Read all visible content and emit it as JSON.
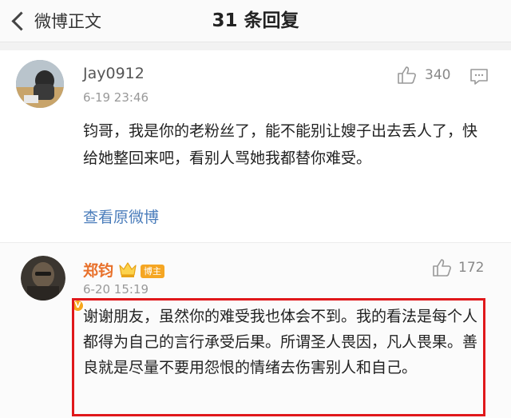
{
  "nav": {
    "back_label": "微博正文",
    "title": "31 条回复"
  },
  "comments": [
    {
      "username": "Jay0912",
      "time": "6-19 23:46",
      "likes": "340",
      "text": "钧哥，我是你的老粉丝了，能不能别让嫂子出去丢人了，快给她整回来吧，看别人骂她我都替你难受。",
      "link_label": "查看原微博"
    },
    {
      "username": "郑钧",
      "badge": "博主",
      "time": "6-20 15:19",
      "likes": "172",
      "text": "谢谢朋友，虽然你的难受我也体会不到。我的看法是每个人都得为自己的言行承受后果。所谓圣人畏因，凡人畏果。善良就是尽量不要用怨恨的情绪去伤害别人和自己。"
    }
  ],
  "colors": {
    "link": "#4b7dbb",
    "host_name": "#e8702a",
    "highlight": "#e0181b",
    "badge": "#f5a623"
  },
  "icons": [
    "back-chevron-icon",
    "thumbs-up-icon",
    "comment-reply-icon",
    "verified-v-icon",
    "crown-icon"
  ]
}
